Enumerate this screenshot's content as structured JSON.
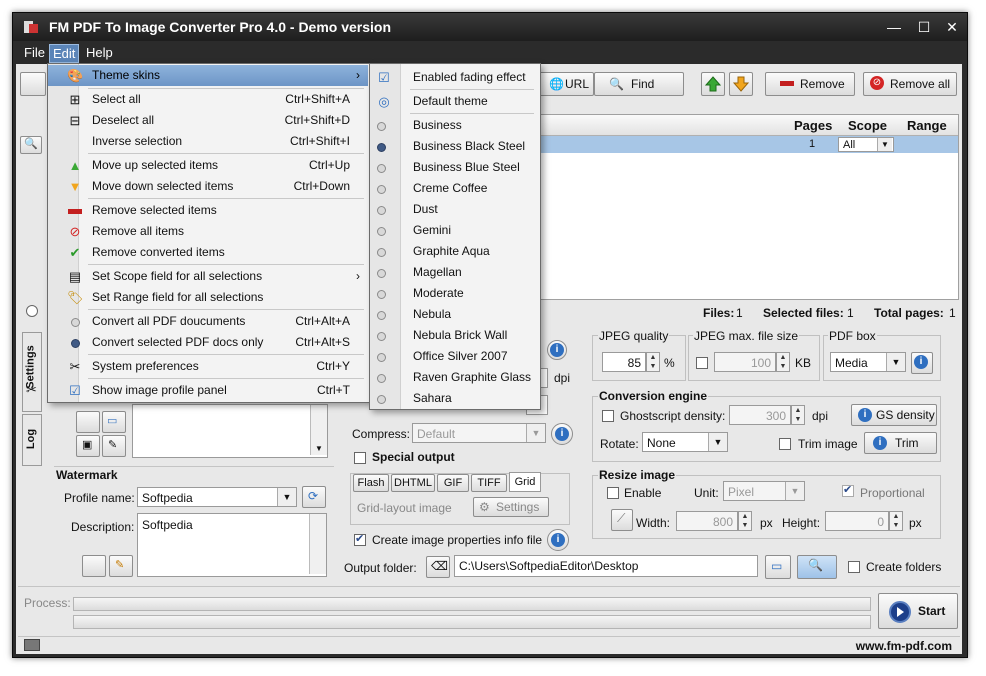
{
  "window": {
    "title": "FM PDF To Image Converter Pro 4.0 - Demo version"
  },
  "menubar": {
    "file": "File",
    "edit": "Edit",
    "help": "Help"
  },
  "toolbar": {
    "url": "URL",
    "find": "Find",
    "remove": "Remove",
    "remove_all": "Remove all"
  },
  "list": {
    "col_pages": "Pages",
    "col_scope": "Scope",
    "col_range": "Range",
    "row_pages": "1",
    "row_scope": "All"
  },
  "status": {
    "files_label": "Files:",
    "files_value": "1",
    "selected_label": "Selected files:",
    "selected_value": "1",
    "total_label": "Total pages:",
    "total_value": "1"
  },
  "side_tabs": {
    "settings": "Settings",
    "log": "Log"
  },
  "edit_menu": {
    "items": [
      {
        "label": "Theme skins",
        "shortcut": ""
      },
      {
        "label": "Select all",
        "shortcut": "Ctrl+Shift+A"
      },
      {
        "label": "Deselect all",
        "shortcut": "Ctrl+Shift+D"
      },
      {
        "label": "Inverse selection",
        "shortcut": "Ctrl+Shift+I"
      },
      {
        "label": "Move up selected items",
        "shortcut": "Ctrl+Up"
      },
      {
        "label": "Move down selected items",
        "shortcut": "Ctrl+Down"
      },
      {
        "label": "Remove selected items",
        "shortcut": ""
      },
      {
        "label": "Remove all items",
        "shortcut": ""
      },
      {
        "label": "Remove converted items",
        "shortcut": ""
      },
      {
        "label": "Set Scope field for all selections",
        "shortcut": ""
      },
      {
        "label": "Set Range field for all selections",
        "shortcut": ""
      },
      {
        "label": "Convert all PDF doucuments",
        "shortcut": "Ctrl+Alt+A"
      },
      {
        "label": "Convert selected PDF docs only",
        "shortcut": "Ctrl+Alt+S"
      },
      {
        "label": "System preferences",
        "shortcut": "Ctrl+Y"
      },
      {
        "label": "Show image profile panel",
        "shortcut": "Ctrl+T"
      }
    ]
  },
  "theme_menu": {
    "fading": "Enabled fading effect",
    "default_theme": "Default theme",
    "themes": [
      "Business",
      "Business Black Steel",
      "Business Blue Steel",
      "Creme Coffee",
      "Dust",
      "Gemini",
      "Graphite Aqua",
      "Magellan",
      "Moderate",
      "Nebula",
      "Nebula Brick Wall",
      "Office Silver 2007",
      "Raven Graphite Glass",
      "Sahara"
    ],
    "selected_theme": "Business Black Steel"
  },
  "settings": {
    "dpi_label": "dpi",
    "compress_label": "Compress:",
    "compress_value": "Default",
    "special_output": "Special output",
    "tabs": [
      "Flash",
      "DHTML",
      "GIF",
      "TIFF",
      "Grid"
    ],
    "grid_layout_label": "Grid-layout image",
    "grid_settings": "Settings",
    "create_info": "Create image properties info file",
    "output_folder_label": "Output folder:",
    "output_folder_value": "C:\\Users\\SoftpediaEditor\\Desktop",
    "create_folders": "Create folders"
  },
  "jpeg": {
    "quality_label": "JPEG quality",
    "quality_value": "85",
    "quality_unit": "%",
    "max_size_label": "JPEG max. file size",
    "max_size_value": "100",
    "max_size_unit": "KB"
  },
  "pdfbox": {
    "label": "PDF box",
    "value": "Media"
  },
  "engine": {
    "title": "Conversion engine",
    "gs_density_label": "Ghostscript density:",
    "gs_density_value": "300",
    "dpi": "dpi",
    "gs_density_btn": "GS density",
    "rotate_label": "Rotate:",
    "rotate_value": "None",
    "trim_label": "Trim image",
    "trim_btn": "Trim"
  },
  "resize": {
    "title": "Resize image",
    "enable": "Enable",
    "unit_label": "Unit:",
    "unit_value": "Pixel",
    "proportional": "Proportional",
    "width_label": "Width:",
    "width_value": "800",
    "px1": "px",
    "height_label": "Height:",
    "height_value": "0",
    "px2": "px"
  },
  "watermark": {
    "title": "Watermark",
    "profile_label": "Profile name:",
    "profile_value": "Softpedia",
    "desc_label": "Description:",
    "desc_value": "Softpedia"
  },
  "process": {
    "label": "Process:",
    "start": "Start"
  },
  "footer": {
    "url": "www.fm-pdf.com"
  }
}
